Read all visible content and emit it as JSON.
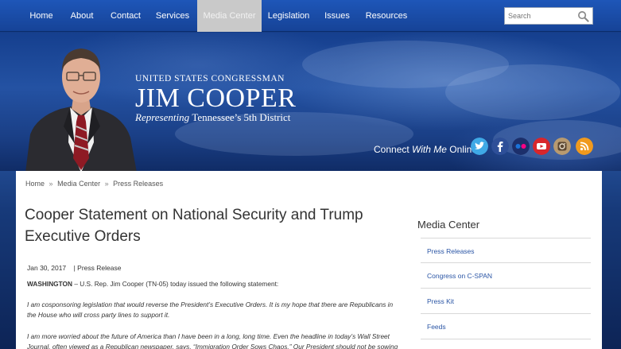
{
  "nav": {
    "items": [
      "Home",
      "About",
      "Contact",
      "Services",
      "Media Center",
      "Legislation",
      "Issues",
      "Resources"
    ],
    "active": "Media Center",
    "search_placeholder": "Search"
  },
  "hero": {
    "line1": "UNITED STATES CONGRESSMAN",
    "name": "JIM COOPER",
    "sub_italic": "Representing",
    "sub_plain": "Tennessee’s 5th District",
    "connect_plain1": "Connect",
    "connect_italic": "With Me",
    "connect_plain2": "Online",
    "social_icons": [
      "twitter-icon",
      "facebook-icon",
      "flickr-icon",
      "youtube-icon",
      "instagram-icon",
      "rss-icon"
    ]
  },
  "breadcrumb": [
    "Home",
    "Media Center",
    "Press Releases"
  ],
  "article": {
    "title": "Cooper Statement on National Security and Trump Executive Orders",
    "date": "Jan 30, 2017",
    "type": "| Press Release",
    "dateline": "WASHINGTON",
    "p1": "– U.S. Rep. Jim Cooper (TN-05) today issued the following statement:",
    "p2": "I am cosponsoring legislation that would reverse the President’s Executive Orders. It is my hope that there are Republicans in the House who will cross party lines to support it.",
    "p3": "I am more worried about the future of America than I have been in a long, long time. Even the headline in today’s Wall Street Journal, often viewed as a Republican newspaper, says, “Immigration Order Sows Chaos.” Our President should not be sowing"
  },
  "sidebar": {
    "title": "Media Center",
    "links": [
      "Press Releases",
      "Congress on C-SPAN",
      "Press Kit",
      "Feeds"
    ]
  },
  "colors": {
    "nav_blue": "#1a4ea8",
    "link_blue": "#2a55a5",
    "active_tab": "#c9c9c9"
  }
}
